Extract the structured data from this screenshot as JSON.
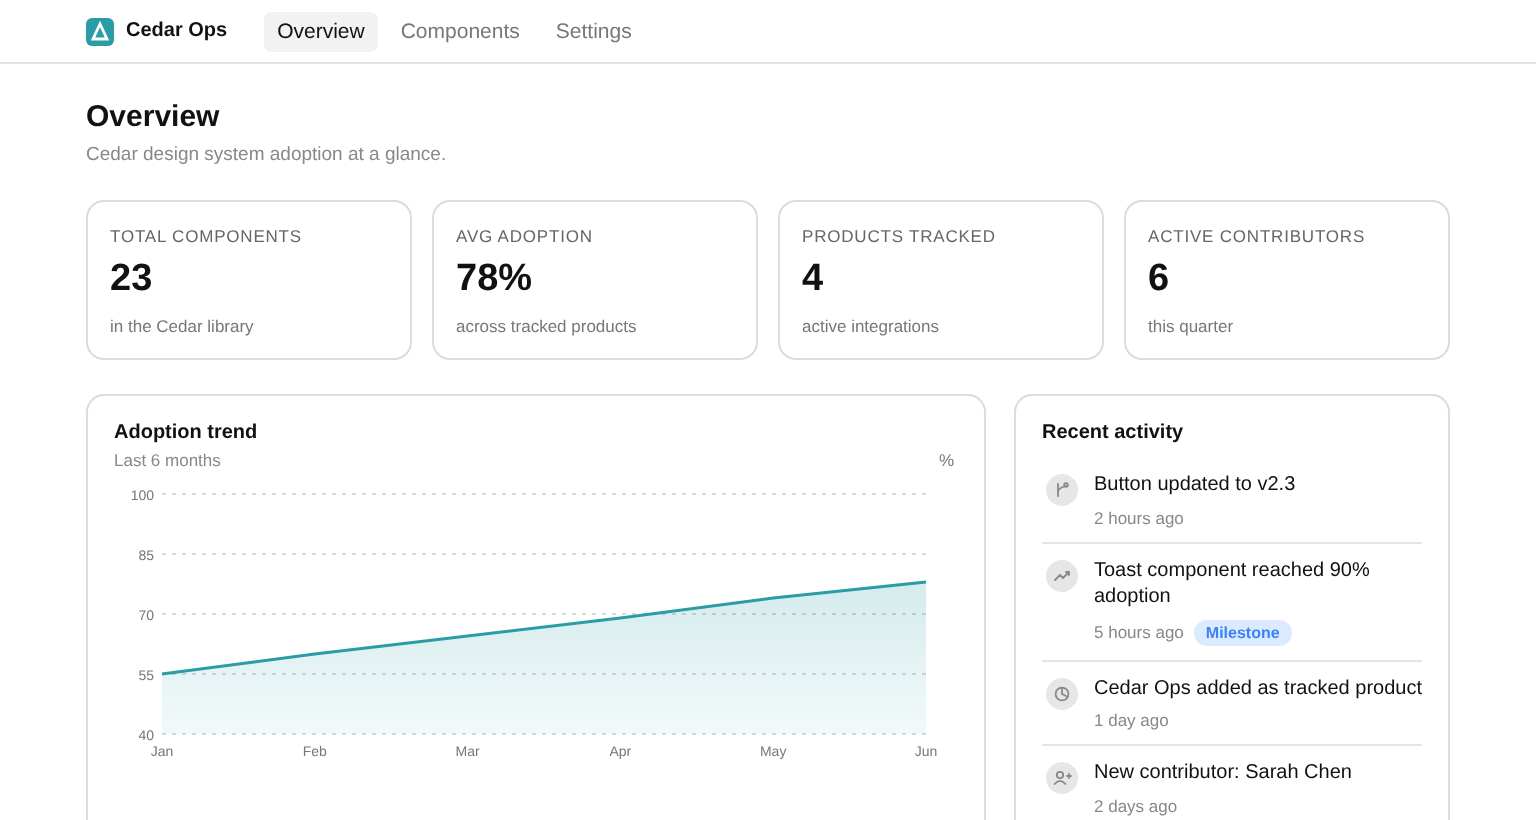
{
  "nav": {
    "brand": "Cedar Ops",
    "tabs": [
      {
        "label": "Overview",
        "selected": true
      },
      {
        "label": "Components",
        "selected": false
      },
      {
        "label": "Settings",
        "selected": false
      }
    ]
  },
  "page": {
    "title": "Overview",
    "subtitle": "Cedar design system adoption at a glance."
  },
  "stats": [
    {
      "label": "TOTAL COMPONENTS",
      "value": "23",
      "note": "in the Cedar library"
    },
    {
      "label": "AVG ADOPTION",
      "value": "78%",
      "note": "across tracked products"
    },
    {
      "label": "PRODUCTS TRACKED",
      "value": "4",
      "note": "active integrations"
    },
    {
      "label": "ACTIVE CONTRIBUTORS",
      "value": "6",
      "note": "this quarter"
    }
  ],
  "trend": {
    "title": "Adoption trend",
    "subtitle": "Last 6 months",
    "unit": "%",
    "chart_data": {
      "type": "area",
      "categories": [
        "Jan",
        "Feb",
        "Mar",
        "Apr",
        "May",
        "Jun"
      ],
      "grid": true,
      "series": [
        {
          "color": "#2a9ca5",
          "values": [
            55,
            60,
            64.5,
            69,
            74,
            78
          ]
        }
      ],
      "ylim": [
        40,
        100
      ],
      "yticks": [
        40,
        55,
        70,
        85,
        100
      ]
    }
  },
  "activity": {
    "title": "Recent activity",
    "items": [
      {
        "kind": "branch",
        "text": "Button updated to v2.3",
        "time": "2 hours ago"
      },
      {
        "kind": "trend",
        "text": "Toast component reached 90% adoption",
        "time": "5 hours ago",
        "tag": "Milestone"
      },
      {
        "kind": "product",
        "text": "Cedar Ops added as tracked product",
        "time": "1 day ago"
      },
      {
        "kind": "user",
        "text": "New contributor: Sarah Chen",
        "time": "2 days ago"
      }
    ]
  }
}
